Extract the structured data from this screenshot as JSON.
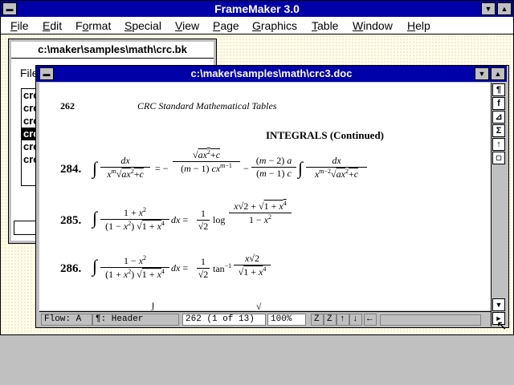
{
  "app": {
    "title": "FrameMaker 3.0"
  },
  "menu": [
    "File",
    "Edit",
    "Format",
    "Special",
    "View",
    "Page",
    "Graphics",
    "Table",
    "Window",
    "Help"
  ],
  "menu_mnemonic": [
    "F",
    "E",
    "o",
    "S",
    "V",
    "P",
    "G",
    "T",
    "W",
    "H"
  ],
  "book": {
    "title": "c:\\maker\\samples\\math\\crc.bk",
    "file_label": "File",
    "items": [
      "cro",
      "cro",
      "cro",
      "cro",
      "cro",
      "cro"
    ],
    "selected_index": 3
  },
  "doc": {
    "title": "c:\\maker\\samples\\math\\crc3.doc",
    "page_number": "262",
    "running_head": "CRC Standard Mathematical Tables",
    "section_head": "INTEGRALS  (Continued)",
    "equations": [
      {
        "number": "284."
      },
      {
        "number": "285."
      },
      {
        "number": "286."
      }
    ],
    "tools": [
      "¶",
      "f",
      "⊿",
      "Σ",
      "↑",
      "▢"
    ],
    "status": {
      "flow": "Flow: A",
      "tag": "¶: Header",
      "page": "262 (1 of 13)",
      "zoom": "100%"
    }
  },
  "colors": {
    "titlebar": "#0000a8",
    "workspace": "#fffde8",
    "chrome": "#c0c0c0"
  }
}
